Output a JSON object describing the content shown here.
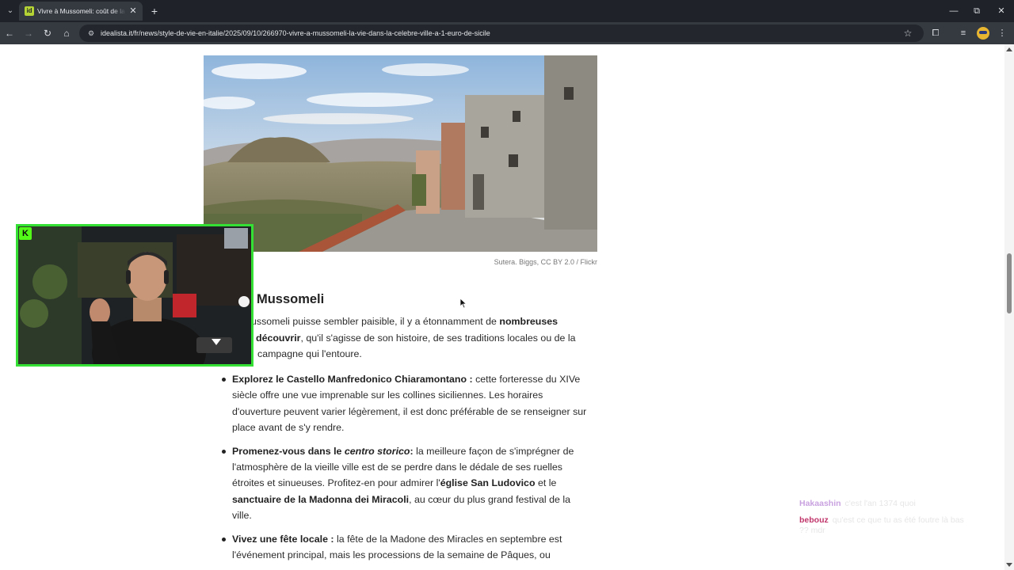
{
  "browser": {
    "tab_title": "Vivre à Mussomeli: coût de la vie",
    "tab_favicon": "id",
    "url": "idealista.it/fr/news/style-de-vie-en-italie/2025/09/10/266970-vivre-a-mussomeli-la-vie-dans-la-celebre-ville-a-1-euro-de-sicile"
  },
  "article": {
    "image_caption": "Sutera. Biggs, CC BY 2.0 / Flickr",
    "heading": "a faire à Mussomeli",
    "intro": {
      "l1a": "ussomeli puisse sembler paisible, il y a étonnamment de ",
      "l1b": "nombreuses",
      "l2a": "découvrir",
      "l2b": ", qu'il s'agisse de son histoire, de ses traditions locales ou de la",
      "l3": "campagne qui l'entoure."
    },
    "bullets": [
      {
        "lead": "Explorez le Castello Manfredonico Chiaramontano :",
        "rest": " cette forteresse du XIVe siècle offre une vue imprenable sur les collines siciliennes. Les horaires d'ouverture peuvent varier légèrement, il est donc préférable de se renseigner sur place avant de s'y rendre."
      },
      {
        "lead": "Promenez-vous dans le ",
        "lead_italic": "centro storico",
        "lead_end": ":",
        "a": " la meilleure façon de s'imprégner de l'atmosphère de la vieille ville est de se perdre dans le dédale de ses ruelles étroites et sinueuses. Profitez-en pour admirer l'",
        "b": "église San Ludovico",
        "c": " et le ",
        "d": "sanctuaire de la Madonna dei Miracoli",
        "e": ", au cœur du plus grand festival de la ville."
      },
      {
        "lead": "Vivez une fête locale :",
        "rest": " la fête de la Madone des Miracles en septembre est l'événement principal, mais les processions de la semaine de Pâques, ou"
      }
    ]
  },
  "stream": {
    "badge": "K",
    "chat": [
      {
        "user": "Hakaashin",
        "color": "#c9a2e0",
        "text": "c'est l'an 1374 quoi"
      },
      {
        "user": "bebouz",
        "color": "#c0356a",
        "text": "qu'est ce que tu as été foutre là bas ?? mdr"
      }
    ]
  },
  "colors": {
    "tab_bar": "#1f2329",
    "toolbar": "#353a41",
    "webcam_border": "#35e035"
  }
}
